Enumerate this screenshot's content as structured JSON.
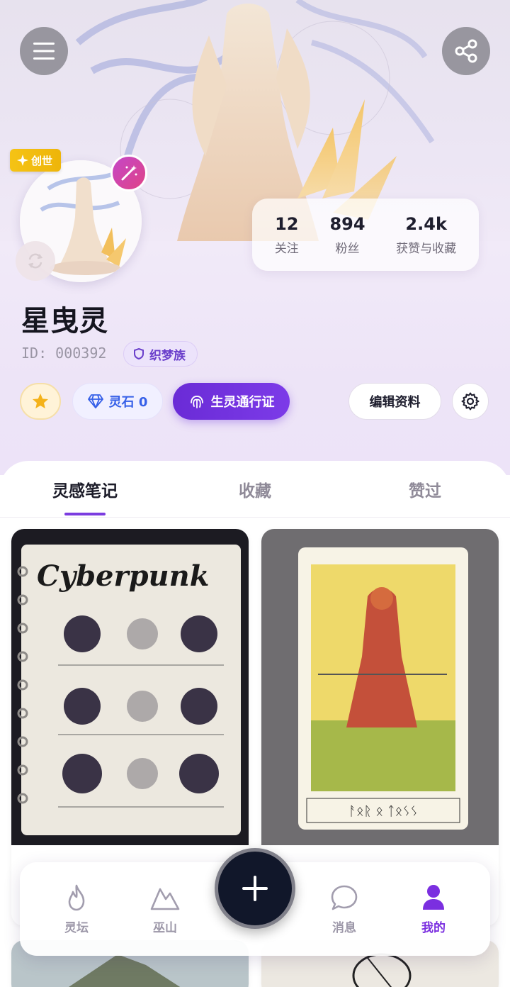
{
  "header": {
    "menu_icon": "menu-icon",
    "share_icon": "share-icon"
  },
  "profile": {
    "badge": "创世",
    "name": "星曳灵",
    "id_text": "ID: 000392",
    "tribe": "织梦族"
  },
  "stats": [
    {
      "value": "12",
      "label": "关注"
    },
    {
      "value": "894",
      "label": "粉丝"
    },
    {
      "value": "2.4k",
      "label": "获赞与收藏"
    }
  ],
  "actions": {
    "stone_label": "灵石 0",
    "pass_label": "生灵通行证",
    "edit_label": "编辑资料"
  },
  "tabs": [
    {
      "label": "灵感笔记",
      "active": true
    },
    {
      "label": "收藏",
      "active": false
    },
    {
      "label": "赞过",
      "active": false
    }
  ],
  "notes": [
    {
      "title": "Cyberpunk",
      "kind": "sketchbook"
    },
    {
      "title": "",
      "kind": "tarot-card"
    }
  ],
  "tarot_caption": "ᚨᛟᚱ ᛟ ᛏᛟᛊᛊ",
  "bottom_nav": [
    {
      "label": "灵坛",
      "icon": "flame-icon",
      "active": false
    },
    {
      "label": "巫山",
      "icon": "mountain-icon",
      "active": false
    },
    {
      "label": "消息",
      "icon": "chat-bubble-icon",
      "active": false
    },
    {
      "label": "我的",
      "icon": "person-icon",
      "active": true
    }
  ],
  "colors": {
    "accent": "#7b3ce0",
    "gold": "#f5c315",
    "fab": "#11172a"
  }
}
